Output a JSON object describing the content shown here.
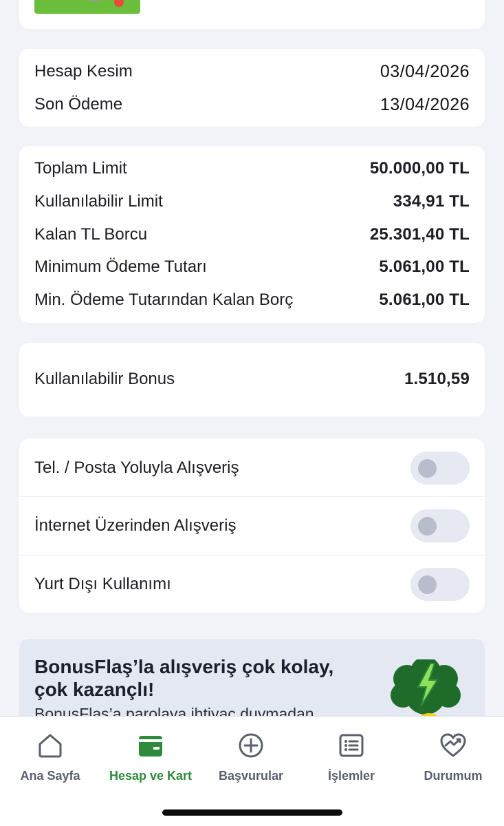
{
  "dates": {
    "rows": [
      {
        "label": "Hesap Kesim",
        "value": "03/04/2026"
      },
      {
        "label": "Son Ödeme",
        "value": "13/04/2026"
      }
    ]
  },
  "limits": {
    "rows": [
      {
        "label": "Toplam Limit",
        "value": "50.000,00 TL"
      },
      {
        "label": "Kullanılabilir Limit",
        "value": "334,91 TL"
      },
      {
        "label": "Kalan TL Borcu",
        "value": "25.301,40 TL"
      },
      {
        "label": "Minimum Ödeme Tutarı",
        "value": "5.061,00 TL"
      },
      {
        "label": "Min. Ödeme Tutarından Kalan Borç",
        "value": "5.061,00 TL"
      }
    ]
  },
  "bonus": {
    "label": "Kullanılabilir Bonus",
    "value": "1.510,59"
  },
  "settings": {
    "toggles": [
      {
        "label": "Tel. / Posta Yoluyla Alışveriş",
        "on": false
      },
      {
        "label": "İnternet Üzerinden Alışveriş",
        "on": false
      },
      {
        "label": "Yurt Dışı Kullanımı",
        "on": false
      }
    ]
  },
  "promo": {
    "title": "BonusFlaş’la alışveriş çok kolay, çok kazançlı!",
    "subtitle": "BonusFlaş’a parolaya ihtiyaç duymadan"
  },
  "tabbar": {
    "tabs": [
      {
        "label": "Ana Sayfa",
        "icon": "home-icon"
      },
      {
        "label": "Hesap ve Kart",
        "icon": "wallet-icon",
        "active": true
      },
      {
        "label": "Başvurular",
        "icon": "plus-circle-icon"
      },
      {
        "label": "İşlemler",
        "icon": "list-icon"
      },
      {
        "label": "Durumum",
        "icon": "heart-chart-icon"
      }
    ]
  },
  "colors": {
    "accent": "#2f8a3b",
    "background": "#f2f3f8",
    "toggle_off": "#e6e8f2"
  }
}
